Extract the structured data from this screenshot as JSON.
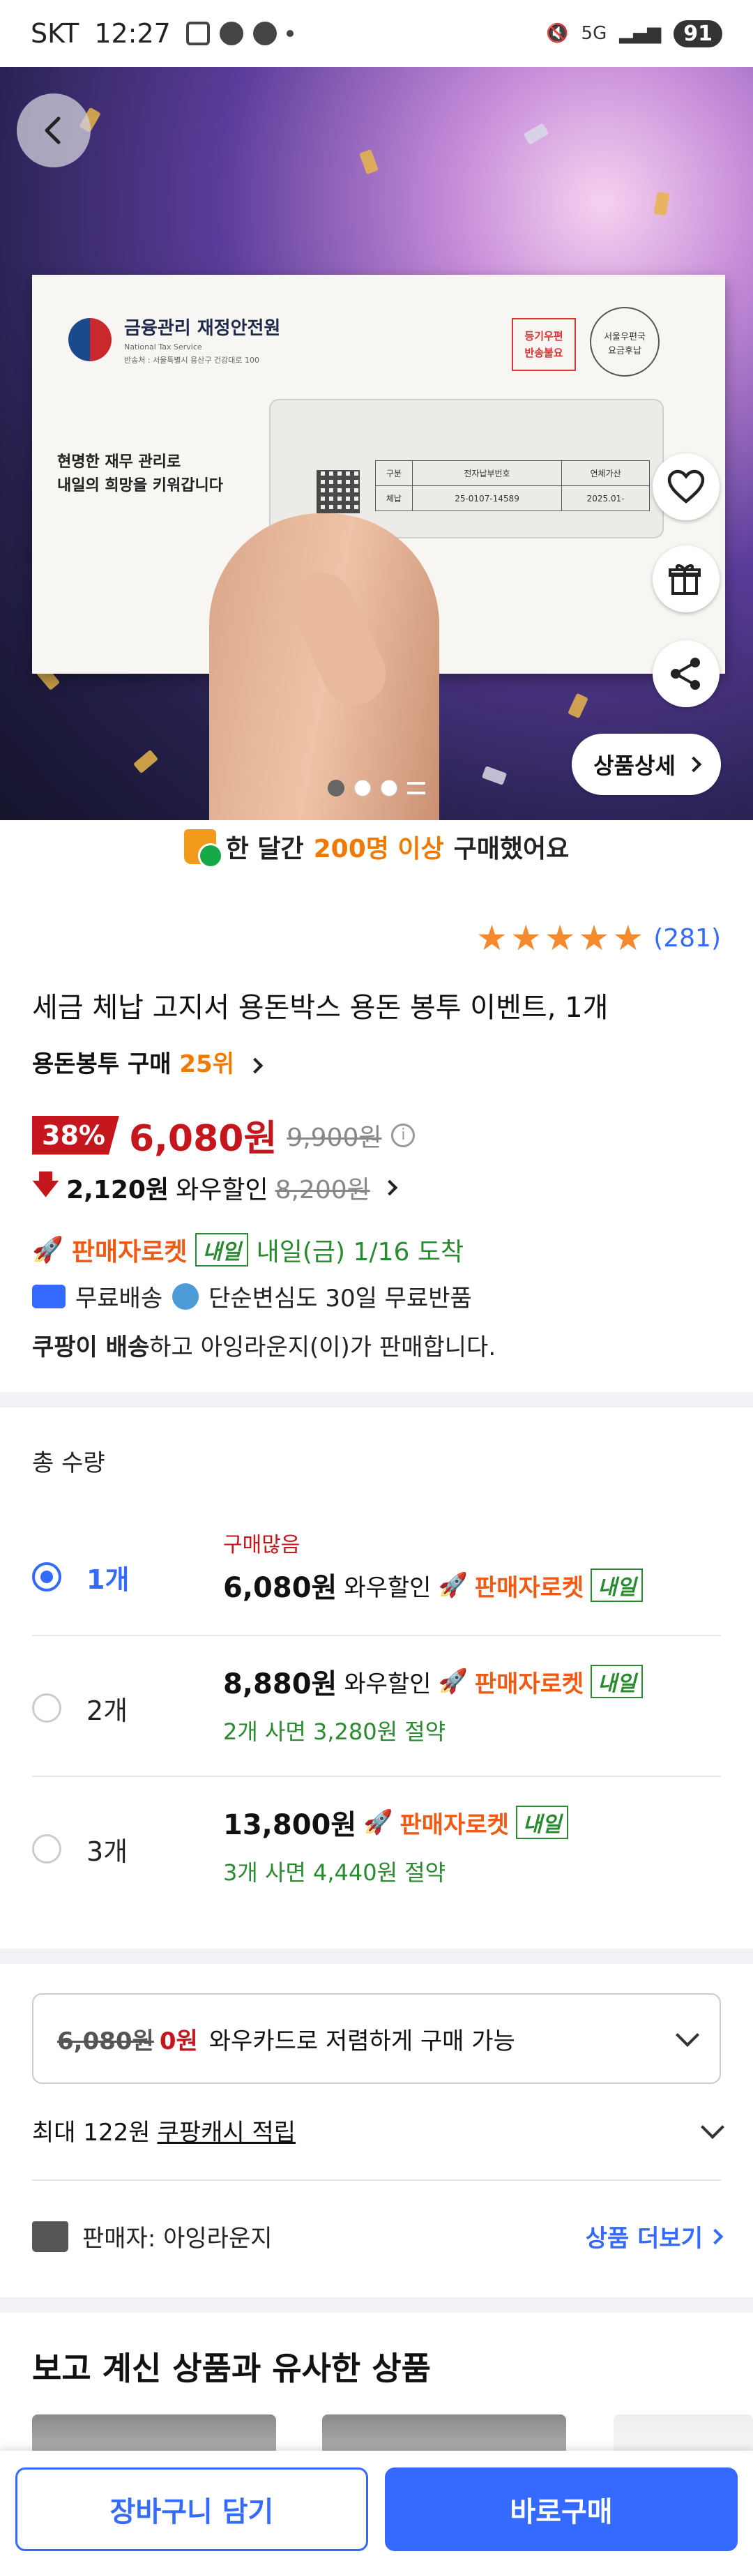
{
  "status_bar": {
    "carrier": "SKT",
    "time": "12:27",
    "network": "5G",
    "battery": "91"
  },
  "hero": {
    "detail_button": "상품상세",
    "envelope": {
      "org_name": "금융관리 재정안전원",
      "org_name_en": "National Tax Service",
      "org_address": "반송처 : 서울특별시 용산구 건강대로 100",
      "slogan_line1": "현명한 재무 관리로",
      "slogan_line2": "내일의 희망을 키워갑니다",
      "red_stamp_line1": "등기우편",
      "red_stamp_line2": "반송불요",
      "postage_line1": "서울우편국",
      "postage_line2": "요금후납",
      "table_headers": [
        "구분",
        "전자납부번호",
        "연체가산"
      ],
      "table_values": [
        "체납",
        "25-0107-14589",
        "2025.01-"
      ]
    },
    "page_dots": 3,
    "active_dot": 2
  },
  "buy_count": {
    "prefix": "한 달간",
    "count": "200명 이상",
    "suffix": "구매했어요"
  },
  "rating": {
    "stars": 5,
    "count": "(281)"
  },
  "product": {
    "title": "세금 체납 고지서 용돈박스 용돈 봉투 이벤트, 1개",
    "rank_label": "용돈봉투 구매",
    "rank_value": "25위",
    "discount": "38%",
    "price": "6,080원",
    "original_price": "9,900원",
    "wow_discount": "2,120원",
    "wow_label": "와우할인",
    "wow_original": "8,200원"
  },
  "delivery": {
    "rocket": "판매자로켓",
    "tomorrow_tag": "내일",
    "arrival": "내일(금) 1/16 도착",
    "free_shipping": "무료배송",
    "free_return": "단순변심도 30일 무료반품",
    "seller_prefix": "쿠팡이 배송",
    "seller_suffix": "하고 아잉라운지(이)가 판매합니다."
  },
  "quantity": {
    "label": "총 수량",
    "options": [
      {
        "qty": "1개",
        "badge": "구매많음",
        "price": "6,080원",
        "wow": "와우할인",
        "rocket": "판매자로켓",
        "tag": "내일",
        "saving": "",
        "selected": true
      },
      {
        "qty": "2개",
        "badge": "",
        "price": "8,880원",
        "wow": "와우할인",
        "rocket": "판매자로켓",
        "tag": "내일",
        "saving": "2개 사면 3,280원 절약",
        "selected": false
      },
      {
        "qty": "3개",
        "badge": "",
        "price": "13,800원",
        "wow": "",
        "rocket": "판매자로켓",
        "tag": "내일",
        "saving": "3개 사면 4,440원 절약",
        "selected": false
      }
    ]
  },
  "card_offer": {
    "strike": "6,080원",
    "zero": "0원",
    "text": "와우카드로 저렴하게 구매 가능"
  },
  "cash": {
    "prefix": "최대 122원",
    "link": "쿠팡캐시 적립"
  },
  "seller": {
    "label": "판매자: 아잉라운지",
    "more": "상품 더보기"
  },
  "similar": {
    "title": "보고 계신 상품과 유사한 상품"
  },
  "bottom": {
    "cart": "장바구니 담기",
    "buy": "바로구매"
  },
  "colors": {
    "accent": "#346aff",
    "price_red": "#c4161c",
    "rocket_orange": "#f05a14",
    "green": "#2a8a30",
    "star": "#f5892e"
  }
}
